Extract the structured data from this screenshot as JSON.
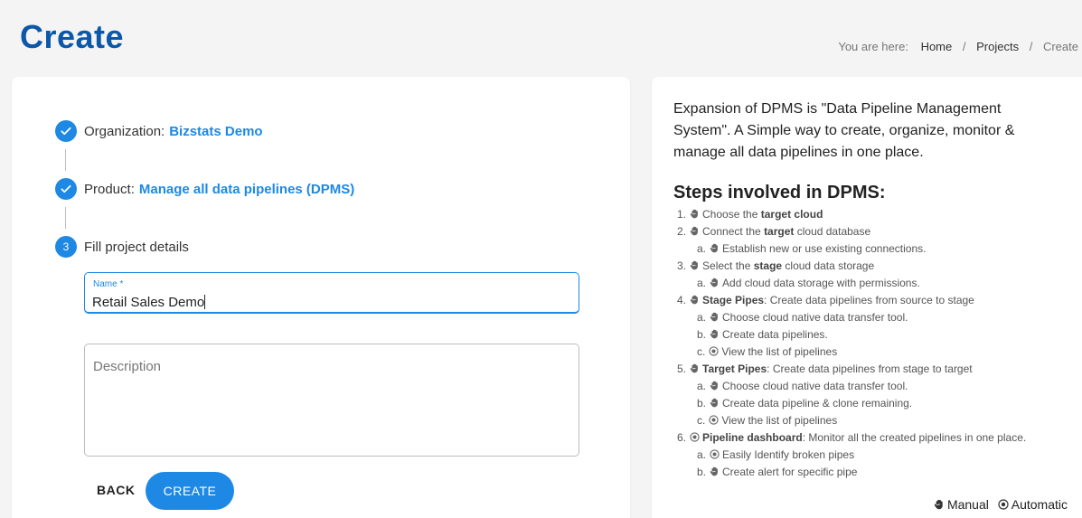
{
  "header": {
    "title": "Create",
    "breadcrumb": {
      "prefix": "You are here:",
      "items": [
        "Home",
        "Projects",
        "Create"
      ]
    }
  },
  "stepper": {
    "steps": [
      {
        "label": "Organization:",
        "value": "Bizstats Demo",
        "state": "done"
      },
      {
        "label": "Product:",
        "value": "Manage all data pipelines (DPMS)",
        "state": "done"
      },
      {
        "number": "3",
        "label": "Fill project details",
        "state": "active"
      }
    ]
  },
  "form": {
    "name_label": "Name *",
    "name_value": "Retail Sales Demo",
    "description_placeholder": "Description",
    "back_label": "BACK",
    "create_label": "CREATE"
  },
  "info": {
    "intro": "Expansion of DPMS is \"Data Pipeline Management System\". A Simple way to create, organize, monitor & manage all data pipelines in one place.",
    "steps_title": "Steps involved in DPMS:",
    "list": [
      {
        "marker": "1.",
        "icon": "hand-icon",
        "pre": "Choose the ",
        "bold": "target cloud",
        "post": ""
      },
      {
        "marker": "2.",
        "icon": "hand-icon",
        "pre": "Connect the ",
        "bold": "target",
        "post": " cloud database"
      },
      {
        "marker": "a.",
        "icon": "hand-icon",
        "pre": "Establish new or use existing connections.",
        "bold": "",
        "post": "",
        "sub": true
      },
      {
        "marker": "3.",
        "icon": "hand-icon",
        "pre": "Select the ",
        "bold": "stage",
        "post": " cloud data storage"
      },
      {
        "marker": "a.",
        "icon": "hand-icon",
        "pre": "Add cloud data storage with permissions.",
        "bold": "",
        "post": "",
        "sub": true
      },
      {
        "marker": "4.",
        "icon": "hand-icon",
        "pre": "",
        "bold": "Stage Pipes",
        "post": ": Create data pipelines from source to stage"
      },
      {
        "marker": "a.",
        "icon": "hand-icon",
        "pre": "Choose cloud native data transfer tool.",
        "bold": "",
        "post": "",
        "sub": true
      },
      {
        "marker": "b.",
        "icon": "hand-icon",
        "pre": "Create data pipelines.",
        "bold": "",
        "post": "",
        "sub": true
      },
      {
        "marker": "c.",
        "icon": "auto-icon",
        "pre": "View the list of pipelines",
        "bold": "",
        "post": "",
        "sub": true
      },
      {
        "marker": "5.",
        "icon": "hand-icon",
        "pre": "",
        "bold": "Target Pipes",
        "post": ": Create data pipelines from stage to target"
      },
      {
        "marker": "a.",
        "icon": "hand-icon",
        "pre": "Choose cloud native data transfer tool.",
        "bold": "",
        "post": "",
        "sub": true
      },
      {
        "marker": "b.",
        "icon": "hand-icon",
        "pre": "Create data pipeline & clone remaining.",
        "bold": "",
        "post": "",
        "sub": true
      },
      {
        "marker": "c.",
        "icon": "auto-icon",
        "pre": "View the list of pipelines",
        "bold": "",
        "post": "",
        "sub": true
      },
      {
        "marker": "6.",
        "icon": "auto-icon",
        "pre": "",
        "bold": "Pipeline dashboard",
        "post": ": Monitor all the created pipelines in one place."
      },
      {
        "marker": "a.",
        "icon": "auto-icon",
        "pre": "Easily Identify broken pipes",
        "bold": "",
        "post": "",
        "sub": true
      },
      {
        "marker": "b.",
        "icon": "hand-icon",
        "pre": "Create alert for specific pipe",
        "bold": "",
        "post": "",
        "sub": true
      }
    ],
    "legend": {
      "manual": "Manual",
      "automatic": "Automatic"
    }
  },
  "colors": {
    "primary": "#1e88e5",
    "title": "#0b57a8",
    "background": "#f4f4f4"
  }
}
